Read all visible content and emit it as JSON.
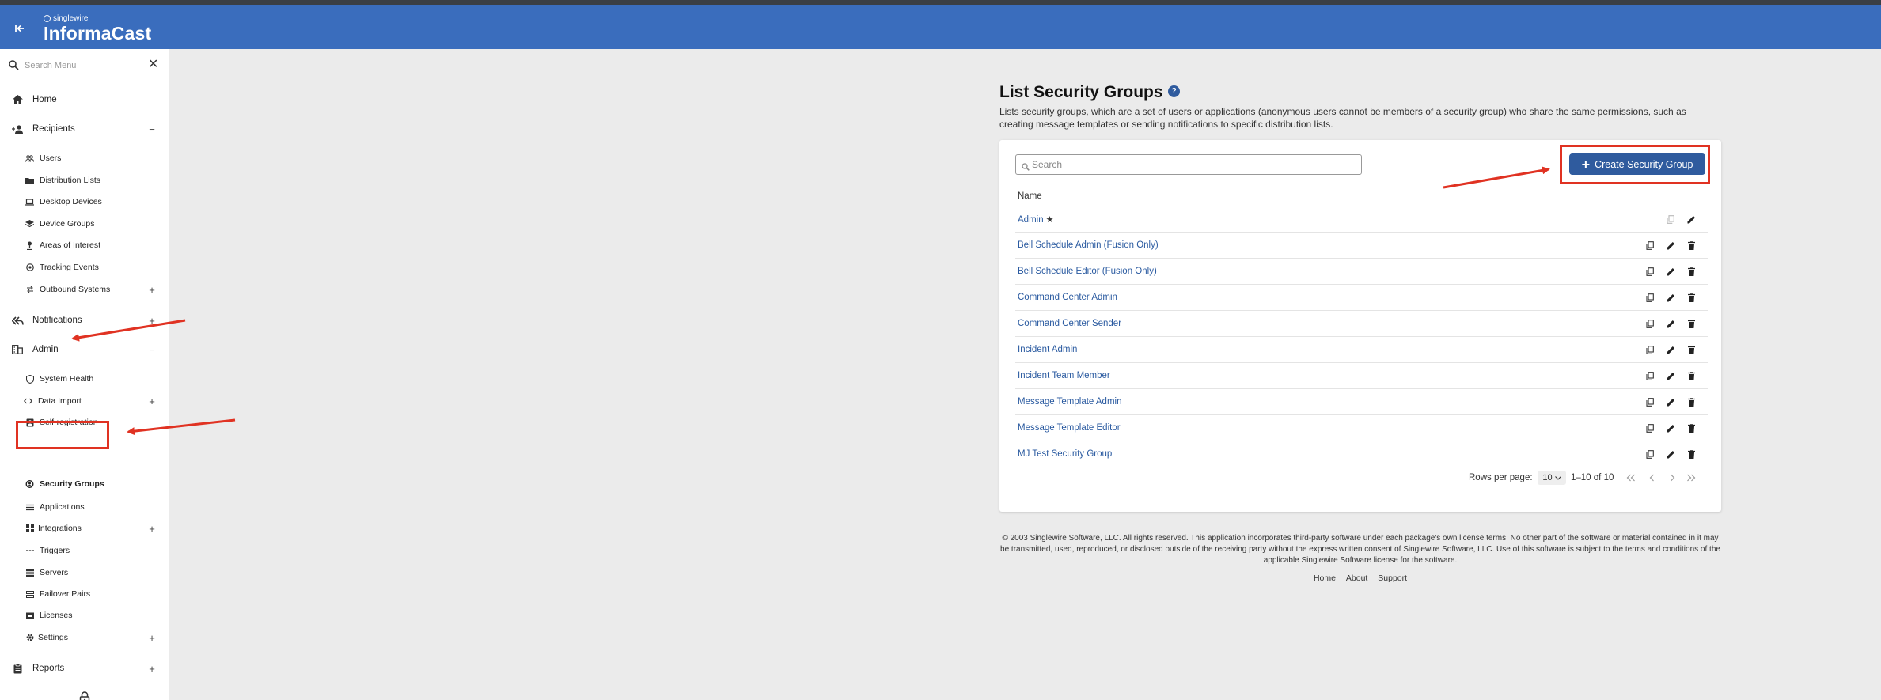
{
  "app": {
    "brand": "singlewire",
    "product": "InformaCast"
  },
  "colors": {
    "topbar": "#3a6dbd",
    "primary": "#2f5b9e",
    "link": "#2a5aa0",
    "annotation": "#e03222"
  },
  "sidebar": {
    "search_placeholder": "Search Menu",
    "items": [
      {
        "label": "Home",
        "icon": "home-icon"
      },
      {
        "label": "Recipients",
        "icon": "person-add-icon",
        "toggle": "−"
      },
      {
        "label": "Users",
        "icon": "people-icon"
      },
      {
        "label": "Distribution Lists",
        "icon": "folder-people-icon"
      },
      {
        "label": "Desktop Devices",
        "icon": "laptop-icon"
      },
      {
        "label": "Device Groups",
        "icon": "layers-icon"
      },
      {
        "label": "Areas of Interest",
        "icon": "person-pin-icon"
      },
      {
        "label": "Tracking Events",
        "icon": "target-icon"
      },
      {
        "label": "Outbound Systems",
        "icon": "swap-icon",
        "toggle": "+"
      },
      {
        "label": "Notifications",
        "icon": "reply-all-icon",
        "toggle": "+"
      },
      {
        "label": "Admin",
        "icon": "building-icon",
        "toggle": "−"
      },
      {
        "label": "System Health",
        "icon": "heart-shield-icon"
      },
      {
        "label": "Data Import",
        "icon": "code-icon",
        "toggle": "+"
      },
      {
        "label": "Self-registration",
        "icon": "badge-icon"
      },
      {
        "label": "Security Groups",
        "icon": "security-groups-icon"
      },
      {
        "label": "Applications",
        "icon": "list-icon"
      },
      {
        "label": "Integrations",
        "icon": "grid-icon",
        "toggle": "+"
      },
      {
        "label": "Triggers",
        "icon": "dashes-icon"
      },
      {
        "label": "Servers",
        "icon": "server-icon"
      },
      {
        "label": "Failover Pairs",
        "icon": "pairs-icon"
      },
      {
        "label": "Licenses",
        "icon": "license-icon"
      },
      {
        "label": "Settings",
        "icon": "gear-icon",
        "toggle": "+"
      },
      {
        "label": "Reports",
        "icon": "clipboard-icon",
        "toggle": "+"
      }
    ]
  },
  "main": {
    "title": "List Security Groups",
    "help": "?",
    "description": "Lists security groups, which are a set of users or applications (anonymous users cannot be members of a security group) who share the same permissions, such as creating message templates or sending notifications to specific distribution lists.",
    "search_placeholder": "Search",
    "create_button": "Create Security Group",
    "column_name": "Name",
    "rows": [
      {
        "name": "Admin",
        "starred": "★"
      },
      {
        "name": "Bell Schedule Admin (Fusion Only)"
      },
      {
        "name": "Bell Schedule Editor (Fusion Only)"
      },
      {
        "name": "Command Center Admin"
      },
      {
        "name": "Command Center Sender"
      },
      {
        "name": "Incident Admin"
      },
      {
        "name": "Incident Team Member"
      },
      {
        "name": "Message Template Admin"
      },
      {
        "name": "Message Template Editor"
      },
      {
        "name": "MJ Test Security Group"
      }
    ],
    "pagination": {
      "rows_per_page_label": "Rows per page:",
      "rows_per_page_value": "10",
      "range": "1–10 of 10"
    }
  },
  "footer": {
    "copyright": "© 2003 Singlewire Software, LLC. All rights reserved. This application incorporates third-party software under each package's own license terms. No other part of the software or material contained in it may be transmitted, used, reproduced, or disclosed outside of the receiving party without the express written consent of Singlewire Software, LLC. Use of this software is subject to the terms and conditions of the applicable Singlewire Software license for the software.",
    "links": [
      "Home",
      "About",
      "Support"
    ]
  }
}
